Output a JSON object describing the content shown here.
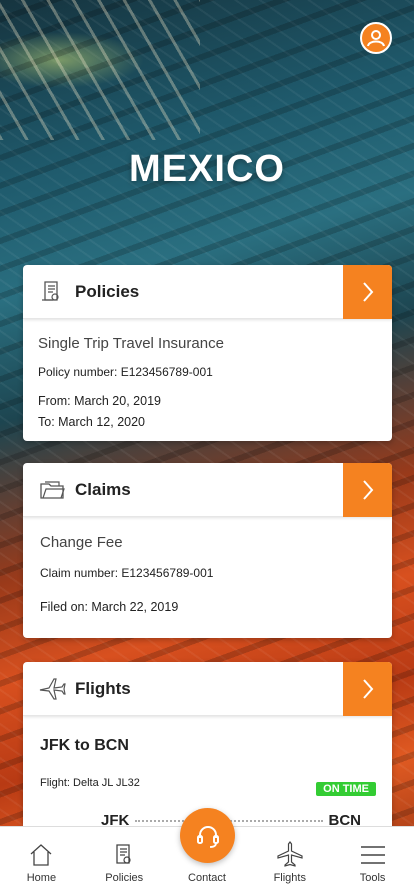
{
  "header": {
    "title": "MEXICO"
  },
  "policies": {
    "label": "Policies",
    "name": "Single Trip Travel Insurance",
    "policy_number": "Policy number: E123456789-001",
    "from": "From: March 20, 2019",
    "to": "To: March 12, 2020"
  },
  "claims": {
    "label": "Claims",
    "name": "Change Fee",
    "claim_number": "Claim number: E123456789-001",
    "filed_on": "Filed on: March 22, 2019"
  },
  "flights": {
    "label": "Flights",
    "route": "JFK to BCN",
    "flight": "Flight: Delta JL JL32",
    "status": "ON TIME",
    "origin": "JFK",
    "destination": "BCN"
  },
  "nav": {
    "home": "Home",
    "policies": "Policies",
    "contact": "Contact",
    "flights": "Flights",
    "tools": "Tools"
  },
  "colors": {
    "accent": "#f58220",
    "status_green": "#33cc33"
  }
}
